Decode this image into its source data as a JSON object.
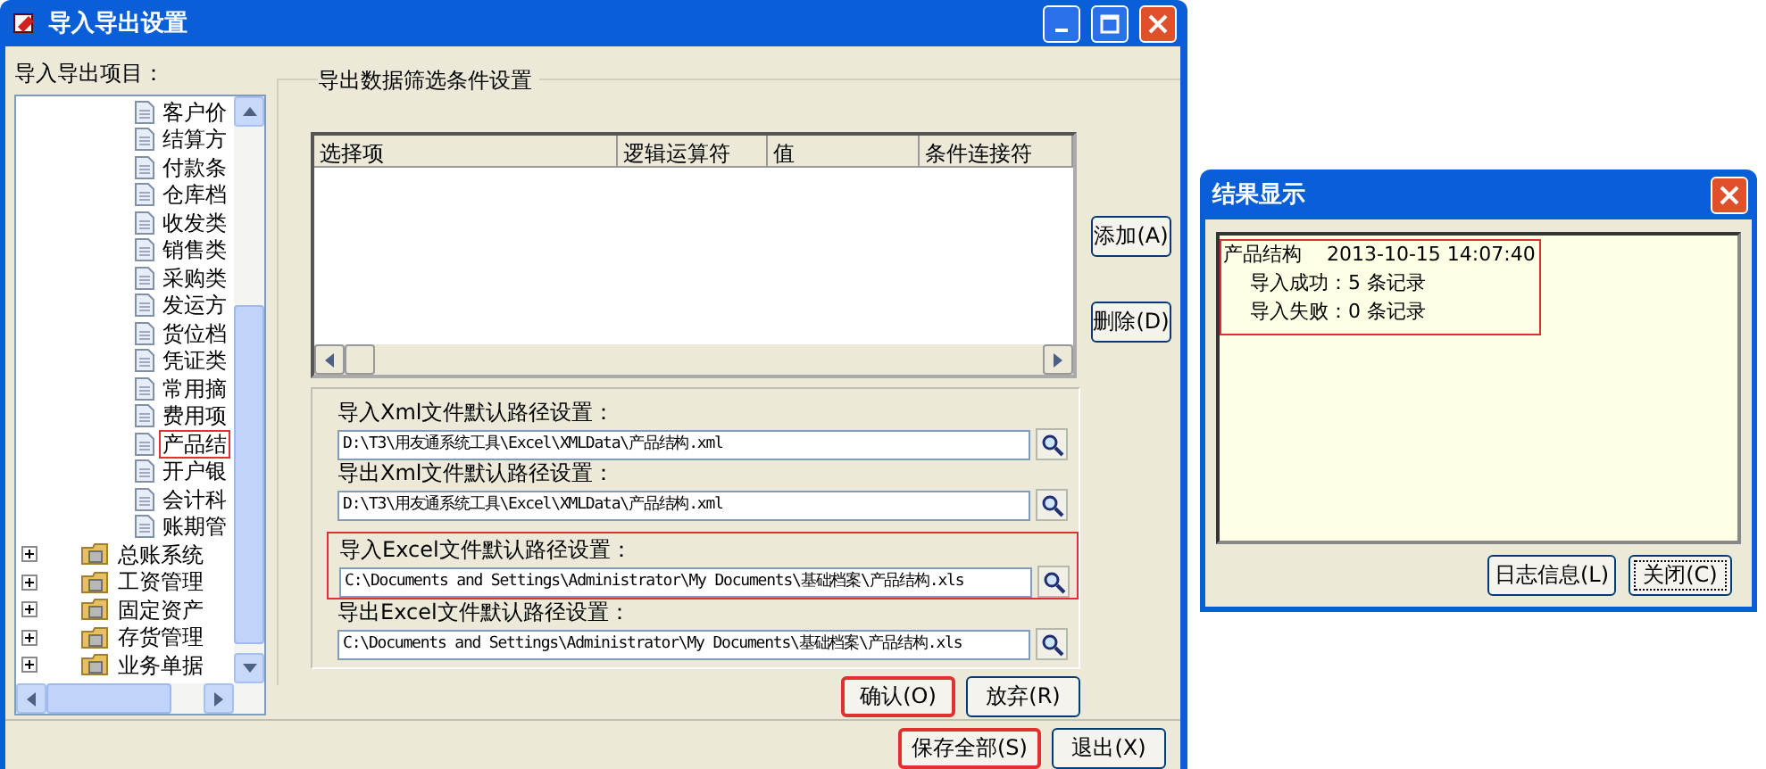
{
  "window": {
    "title": "导入导出设置"
  },
  "tree": {
    "label": "导入导出项目：",
    "items": [
      {
        "kind": "group",
        "children": [
          {
            "kind": "document",
            "label": "客户价",
            "highlighted": false
          },
          {
            "kind": "document",
            "label": "结算方",
            "highlighted": false
          },
          {
            "kind": "document",
            "label": "付款条",
            "highlighted": false
          },
          {
            "kind": "document",
            "label": "仓库档",
            "highlighted": false
          },
          {
            "kind": "document",
            "label": "收发类",
            "highlighted": false
          },
          {
            "kind": "document",
            "label": "销售类",
            "highlighted": false
          },
          {
            "kind": "document",
            "label": "采购类",
            "highlighted": false
          },
          {
            "kind": "document",
            "label": "发运方",
            "highlighted": false
          },
          {
            "kind": "document",
            "label": "货位档",
            "highlighted": false
          },
          {
            "kind": "document",
            "label": "凭证类",
            "highlighted": false
          },
          {
            "kind": "document",
            "label": "常用摘",
            "highlighted": false
          },
          {
            "kind": "document",
            "label": "费用项",
            "highlighted": false
          },
          {
            "kind": "document",
            "label": "产品结",
            "highlighted": true
          },
          {
            "kind": "document",
            "label": "开户银",
            "highlighted": false
          },
          {
            "kind": "document",
            "label": "会计科",
            "highlighted": false
          },
          {
            "kind": "document",
            "label": "账期管",
            "highlighted": false
          }
        ]
      },
      {
        "kind": "folder",
        "label": "总账系统",
        "expanded": false
      },
      {
        "kind": "folder",
        "label": "工资管理",
        "expanded": false
      },
      {
        "kind": "folder",
        "label": "固定资产",
        "expanded": false
      },
      {
        "kind": "folder",
        "label": "存货管理",
        "expanded": false
      },
      {
        "kind": "folder",
        "label": "业务单据",
        "expanded": false
      }
    ]
  },
  "filter": {
    "title": "导出数据筛选条件设置",
    "columns": [
      "选择项",
      "逻辑运算符",
      "值",
      "条件连接符"
    ],
    "buttons": [
      "添加(A)",
      "删除(D)"
    ]
  },
  "paths": [
    {
      "label": "导入Xml文件默认路径设置：",
      "value": "D:\\T3\\用友通系统工具\\Excel\\XMLData\\产品结构.xml",
      "highlighted": false
    },
    {
      "label": "导出Xml文件默认路径设置：",
      "value": "D:\\T3\\用友通系统工具\\Excel\\XMLData\\产品结构.xml",
      "highlighted": false
    },
    {
      "label": "导入Excel文件默认路径设置：",
      "value": "C:\\Documents and Settings\\Administrator\\My Documents\\基础档案\\产品结构.xls",
      "highlighted": true
    },
    {
      "label": "导出Excel文件默认路径设置：",
      "value": "C:\\Documents and Settings\\Administrator\\My Documents\\基础档案\\产品结构.xls",
      "highlighted": false
    }
  ],
  "form_buttons": [
    {
      "label": "确认(O)",
      "highlighted": true
    },
    {
      "label": "放弃(R)",
      "highlighted": false
    }
  ],
  "footer_buttons": [
    {
      "label": "保存全部(S)",
      "highlighted": true
    },
    {
      "label": "退出(X)",
      "highlighted": false
    }
  ],
  "result_dialog": {
    "title": "结果显示",
    "item": "产品结构",
    "time": "2013-10-15 14:07:40",
    "lines": [
      "导入成功：5 条记录",
      "导入失败：0 条记录"
    ],
    "highlighted": true,
    "buttons": [
      {
        "label": "日志信息(L)",
        "focused": false
      },
      {
        "label": "关闭(C)",
        "focused": true
      }
    ]
  }
}
